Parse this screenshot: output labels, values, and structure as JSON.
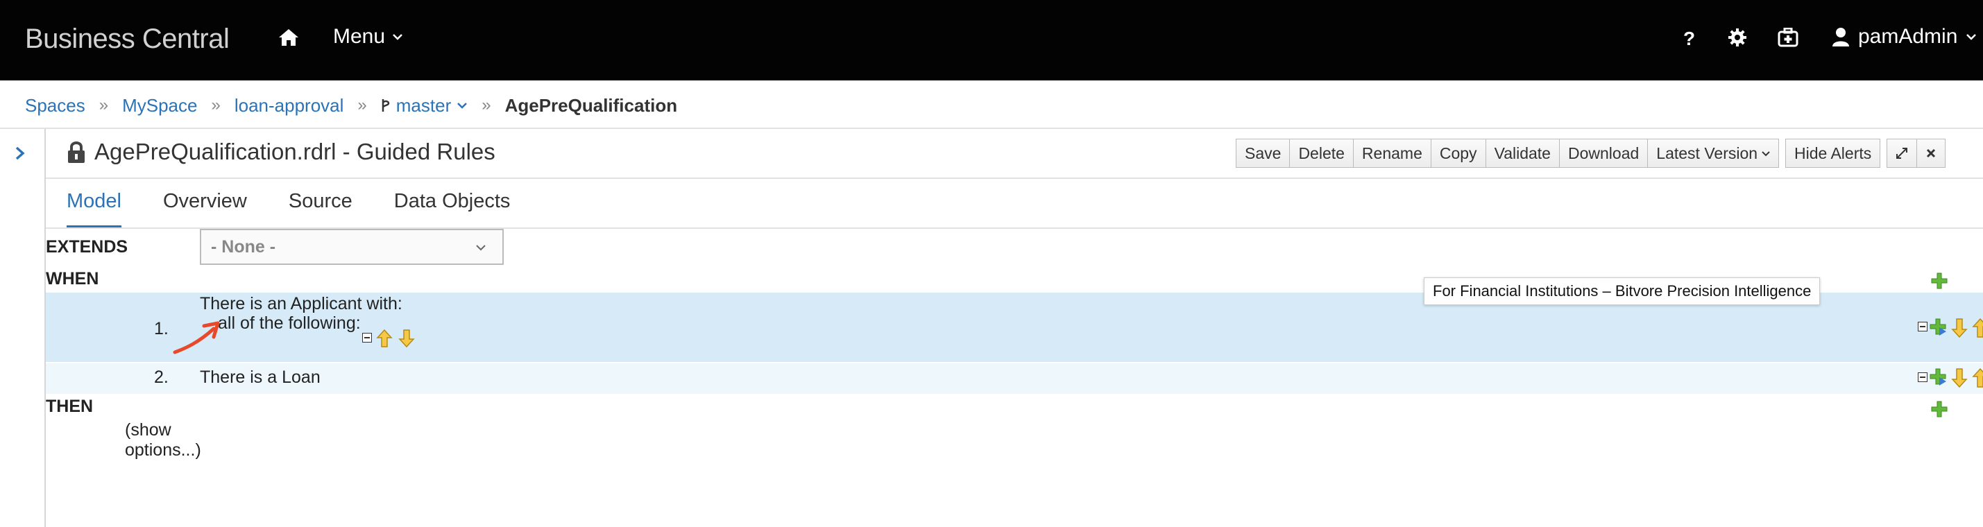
{
  "navbar": {
    "brand": "Business Central",
    "menu_label": "Menu",
    "help_label": "?",
    "user_label": "pamAdmin"
  },
  "breadcrumb": {
    "items": [
      "Spaces",
      "MySpace",
      "loan-approval"
    ],
    "branch": "master",
    "current": "AgePreQualification"
  },
  "editor": {
    "title": "AgePreQualification.rdrl - Guided Rules",
    "toolbar": {
      "save": "Save",
      "delete": "Delete",
      "rename": "Rename",
      "copy": "Copy",
      "validate": "Validate",
      "download": "Download",
      "latest_version": "Latest Version",
      "hide_alerts": "Hide Alerts"
    },
    "tabs": [
      "Model",
      "Overview",
      "Source",
      "Data Objects"
    ],
    "active_tab": "Model"
  },
  "rule": {
    "extends_label": "EXTENDS",
    "extends_value": "- None -",
    "when_label": "WHEN",
    "then_label": "THEN",
    "conditions": [
      {
        "num": "1.",
        "line1": "There is an Applicant with:",
        "line2": "all of the following:"
      },
      {
        "num": "2.",
        "line1": "There is a Loan"
      }
    ],
    "show_options_line1": "(show",
    "show_options_line2": "options...)"
  },
  "tooltip": "For Financial Institutions – Bitvore Precision Intelligence",
  "colors": {
    "navbar_bg": "#030303",
    "link": "#2b73b6",
    "row_highlight": "#d6ebf7",
    "row_alt": "#eef7fc",
    "annotation_arrow": "#e8492b"
  }
}
